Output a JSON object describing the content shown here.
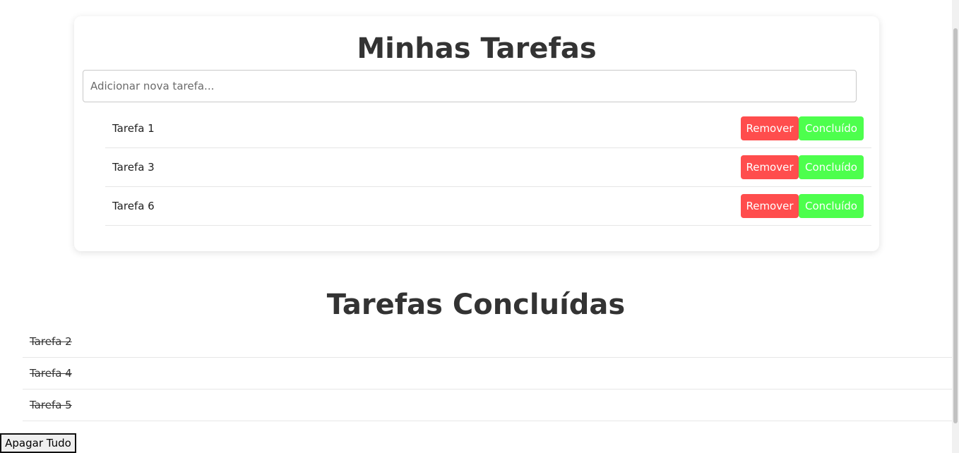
{
  "main": {
    "title": "Minhas Tarefas",
    "input": {
      "placeholder": "Adicionar nova tarefa...",
      "value": ""
    },
    "tasks": [
      {
        "label": "Tarefa 1",
        "remove_label": "Remover",
        "done_label": "Concluído"
      },
      {
        "label": "Tarefa 3",
        "remove_label": "Remover",
        "done_label": "Concluído"
      },
      {
        "label": "Tarefa 6",
        "remove_label": "Remover",
        "done_label": "Concluído"
      }
    ]
  },
  "completed": {
    "title": "Tarefas Concluídas",
    "tasks": [
      {
        "label": "Tarefa 2"
      },
      {
        "label": "Tarefa 4"
      },
      {
        "label": "Tarefa 5"
      }
    ]
  },
  "clear_button": {
    "label": "Apagar Tudo"
  },
  "colors": {
    "remove": "#ff4d4d",
    "done": "#4dff4d"
  }
}
